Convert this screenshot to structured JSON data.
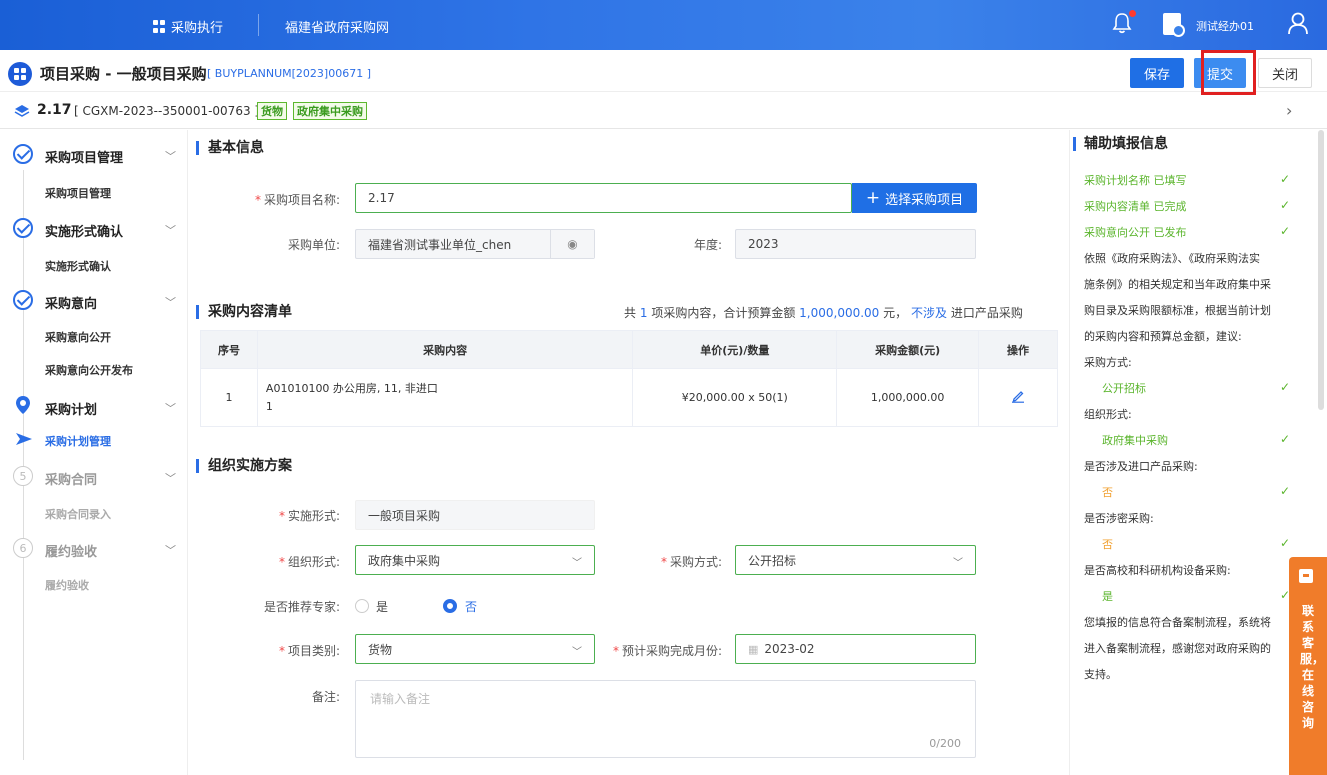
{
  "topbar": {
    "menu_label": "采购执行",
    "site_name": "福建省政府采购网",
    "user_name": "测试经办01"
  },
  "header": {
    "title": "项目采购 - 一般项目采购",
    "code": "[ BUYPLANNUM[2023]00671 ]",
    "save_label": "保存",
    "submit_label": "提交",
    "close_label": "关闭",
    "version": "2.17",
    "version_code": "[ CGXM-2023--350001-00763 ]",
    "tag_goods": "货物",
    "tag_central": "政府集中采购"
  },
  "sidebar": {
    "groups": [
      {
        "label": "采购项目管理",
        "icon": "check",
        "subs": [
          "采购项目管理"
        ]
      },
      {
        "label": "实施形式确认",
        "icon": "check",
        "subs": [
          "实施形式确认"
        ]
      },
      {
        "label": "采购意向",
        "icon": "check",
        "subs": [
          "采购意向公开",
          "采购意向公开发布"
        ]
      },
      {
        "label": "采购计划",
        "icon": "location",
        "subs": [
          "采购计划管理"
        ]
      },
      {
        "label": "采购合同",
        "icon": "5",
        "subs": [
          "采购合同录入"
        ]
      },
      {
        "label": "履约验收",
        "icon": "6",
        "subs": [
          "履约验收"
        ]
      }
    ]
  },
  "basic": {
    "section_title": "基本信息",
    "name_label": "采购项目名称:",
    "name_value": "2.17",
    "pick_label": "选择采购项目",
    "unit_label": "采购单位:",
    "unit_value": "福建省测试事业单位_chen",
    "year_label": "年度:",
    "year_value": "2023"
  },
  "list": {
    "section_title": "采购内容清单",
    "summary_prefix": "共",
    "summary_count": "1",
    "summary_mid": "项采购内容，合计预算金额",
    "summary_amount": "1,000,000.00",
    "summary_unit": "元，",
    "summary_flag": "不涉及",
    "summary_suffix": "进口产品采购",
    "columns": [
      "序号",
      "采购内容",
      "单价(元)/数量",
      "采购金额(元)",
      "操作"
    ],
    "rows": [
      {
        "no": "1",
        "content_line1": "A01010100 办公用房, 11, 非进口",
        "content_line2": "1",
        "price": "¥20,000.00 x 50(1)",
        "amount": "1,000,000.00"
      }
    ]
  },
  "plan": {
    "section_title": "组织实施方案",
    "impl_label": "实施形式:",
    "impl_value": "一般项目采购",
    "org_label": "组织形式:",
    "org_value": "政府集中采购",
    "method_label": "采购方式:",
    "method_value": "公开招标",
    "expert_label": "是否推荐专家:",
    "expert_yes": "是",
    "expert_no": "否",
    "category_label": "项目类别:",
    "category_value": "货物",
    "month_label": "预计采购完成月份:",
    "month_value": "2023-02",
    "remark_label": "备注:",
    "remark_placeholder": "请输入备注",
    "remark_count": "0/200"
  },
  "assist": {
    "title": "辅助填报信息",
    "rows": [
      {
        "text": "采购计划名称 已填写",
        "style": "green",
        "check": true
      },
      {
        "text": "采购内容清单 已完成",
        "style": "green",
        "check": true
      },
      {
        "text": "采购意向公开 已发布",
        "style": "green",
        "check": true
      },
      {
        "text": "依照《政府采购法》、《政府采购法实",
        "style": "dark",
        "check": false
      },
      {
        "text": "施条例》的相关规定和当年政府集中采",
        "style": "dark",
        "check": false
      },
      {
        "text": "购目录及采购限额标准，根据当前计划",
        "style": "dark",
        "check": false
      },
      {
        "text": "的采购内容和预算总金额，建议:",
        "style": "dark",
        "check": false
      },
      {
        "text": "采购方式:",
        "style": "dark",
        "check": false
      },
      {
        "text": "公开招标",
        "style": "green-indent",
        "check": true
      },
      {
        "text": "组织形式:",
        "style": "dark",
        "check": false
      },
      {
        "text": "政府集中采购",
        "style": "green-indent",
        "check": true
      },
      {
        "text": "是否涉及进口产品采购:",
        "style": "dark",
        "check": false
      },
      {
        "text": "否",
        "style": "orange-indent",
        "check": true
      },
      {
        "text": "是否涉密采购:",
        "style": "dark",
        "check": false
      },
      {
        "text": "否",
        "style": "orange-indent",
        "check": true
      },
      {
        "text": "是否高校和科研机构设备采购:",
        "style": "dark",
        "check": false
      },
      {
        "text": "是",
        "style": "green-indent",
        "check": true
      },
      {
        "text": "您填报的信息符合备案制流程，系统将",
        "style": "dark",
        "check": false
      },
      {
        "text": "进入备案制流程，感谢您对政府采购的",
        "style": "dark",
        "check": false
      },
      {
        "text": "支持。",
        "style": "dark",
        "check": false
      }
    ]
  },
  "customer_service": {
    "label": "联系客服，在线咨询"
  }
}
